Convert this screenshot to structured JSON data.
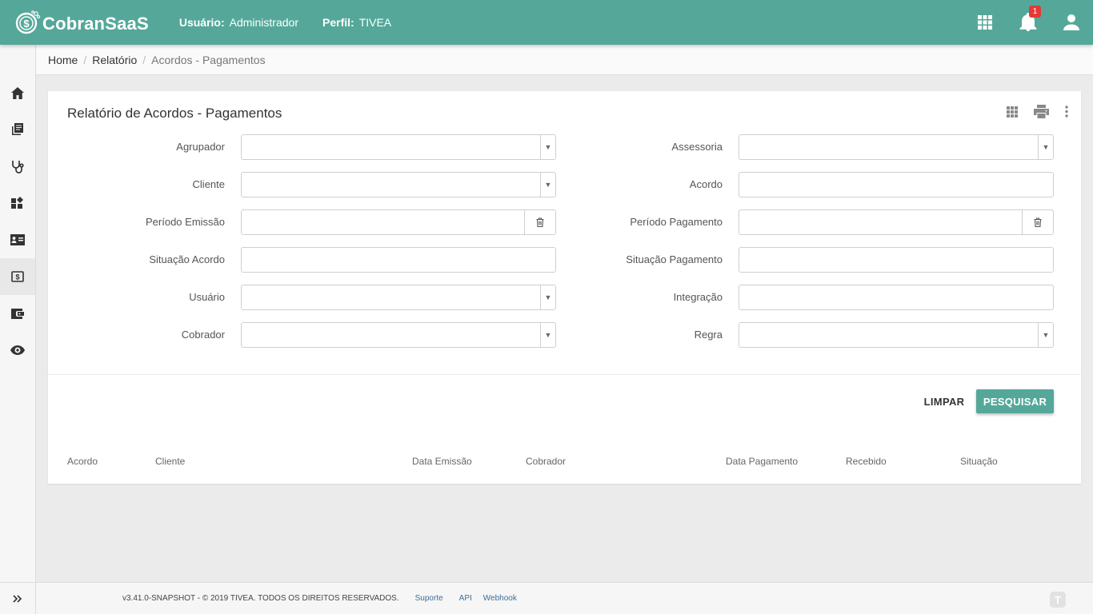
{
  "header": {
    "brand": "CobranSaaS",
    "user_label": "Usuário:",
    "user_value": "Administrador",
    "profile_label": "Perfil:",
    "profile_value": "TIVEA",
    "notification_count": "1",
    "accent_color": "#55a899"
  },
  "sidebar": {
    "items": [
      {
        "icon": "home-icon"
      },
      {
        "icon": "library-books-icon"
      },
      {
        "icon": "stethoscope-icon"
      },
      {
        "icon": "widgets-icon"
      },
      {
        "icon": "contact-card-icon"
      },
      {
        "icon": "money-icon",
        "active": true
      },
      {
        "icon": "wallet-icon"
      },
      {
        "icon": "eye-icon"
      }
    ],
    "expand_icon": "double-chevron-right-icon"
  },
  "breadcrumb": {
    "home": "Home",
    "section": "Relatório",
    "current": "Acordos - Pagamentos",
    "separator": "/"
  },
  "card": {
    "title": "Relatório de Acordos - Pagamentos"
  },
  "filters": {
    "left": [
      {
        "label": "Agrupador",
        "value": "",
        "kind": "select"
      },
      {
        "label": "Cliente",
        "value": "",
        "kind": "select"
      },
      {
        "label": "Período Emissão",
        "value": "",
        "kind": "date-range"
      },
      {
        "label": "Situação Acordo",
        "value": "",
        "kind": "text"
      },
      {
        "label": "Usuário",
        "value": "",
        "kind": "select"
      },
      {
        "label": "Cobrador",
        "value": "",
        "kind": "select"
      }
    ],
    "right": [
      {
        "label": "Assessoria",
        "value": "",
        "kind": "select"
      },
      {
        "label": "Acordo",
        "value": "",
        "kind": "text"
      },
      {
        "label": "Período Pagamento",
        "value": "",
        "kind": "date-range"
      },
      {
        "label": "Situação Pagamento",
        "value": "",
        "kind": "text"
      },
      {
        "label": "Integração",
        "value": "",
        "kind": "text"
      },
      {
        "label": "Regra",
        "value": "",
        "kind": "select"
      }
    ]
  },
  "actions": {
    "clear": "LIMPAR",
    "search": "PESQUISAR"
  },
  "table": {
    "columns": [
      "Acordo",
      "Cliente",
      "Data Emissão",
      "Cobrador",
      "Data Pagamento",
      "Recebido",
      "Situação"
    ]
  },
  "footer": {
    "version": "v3.41.0-SNAPSHOT - © 2019 TIVEA. TODOS OS DIREITOS RESERVADOS.",
    "links": [
      "Suporte",
      "API",
      "Webhook"
    ]
  }
}
